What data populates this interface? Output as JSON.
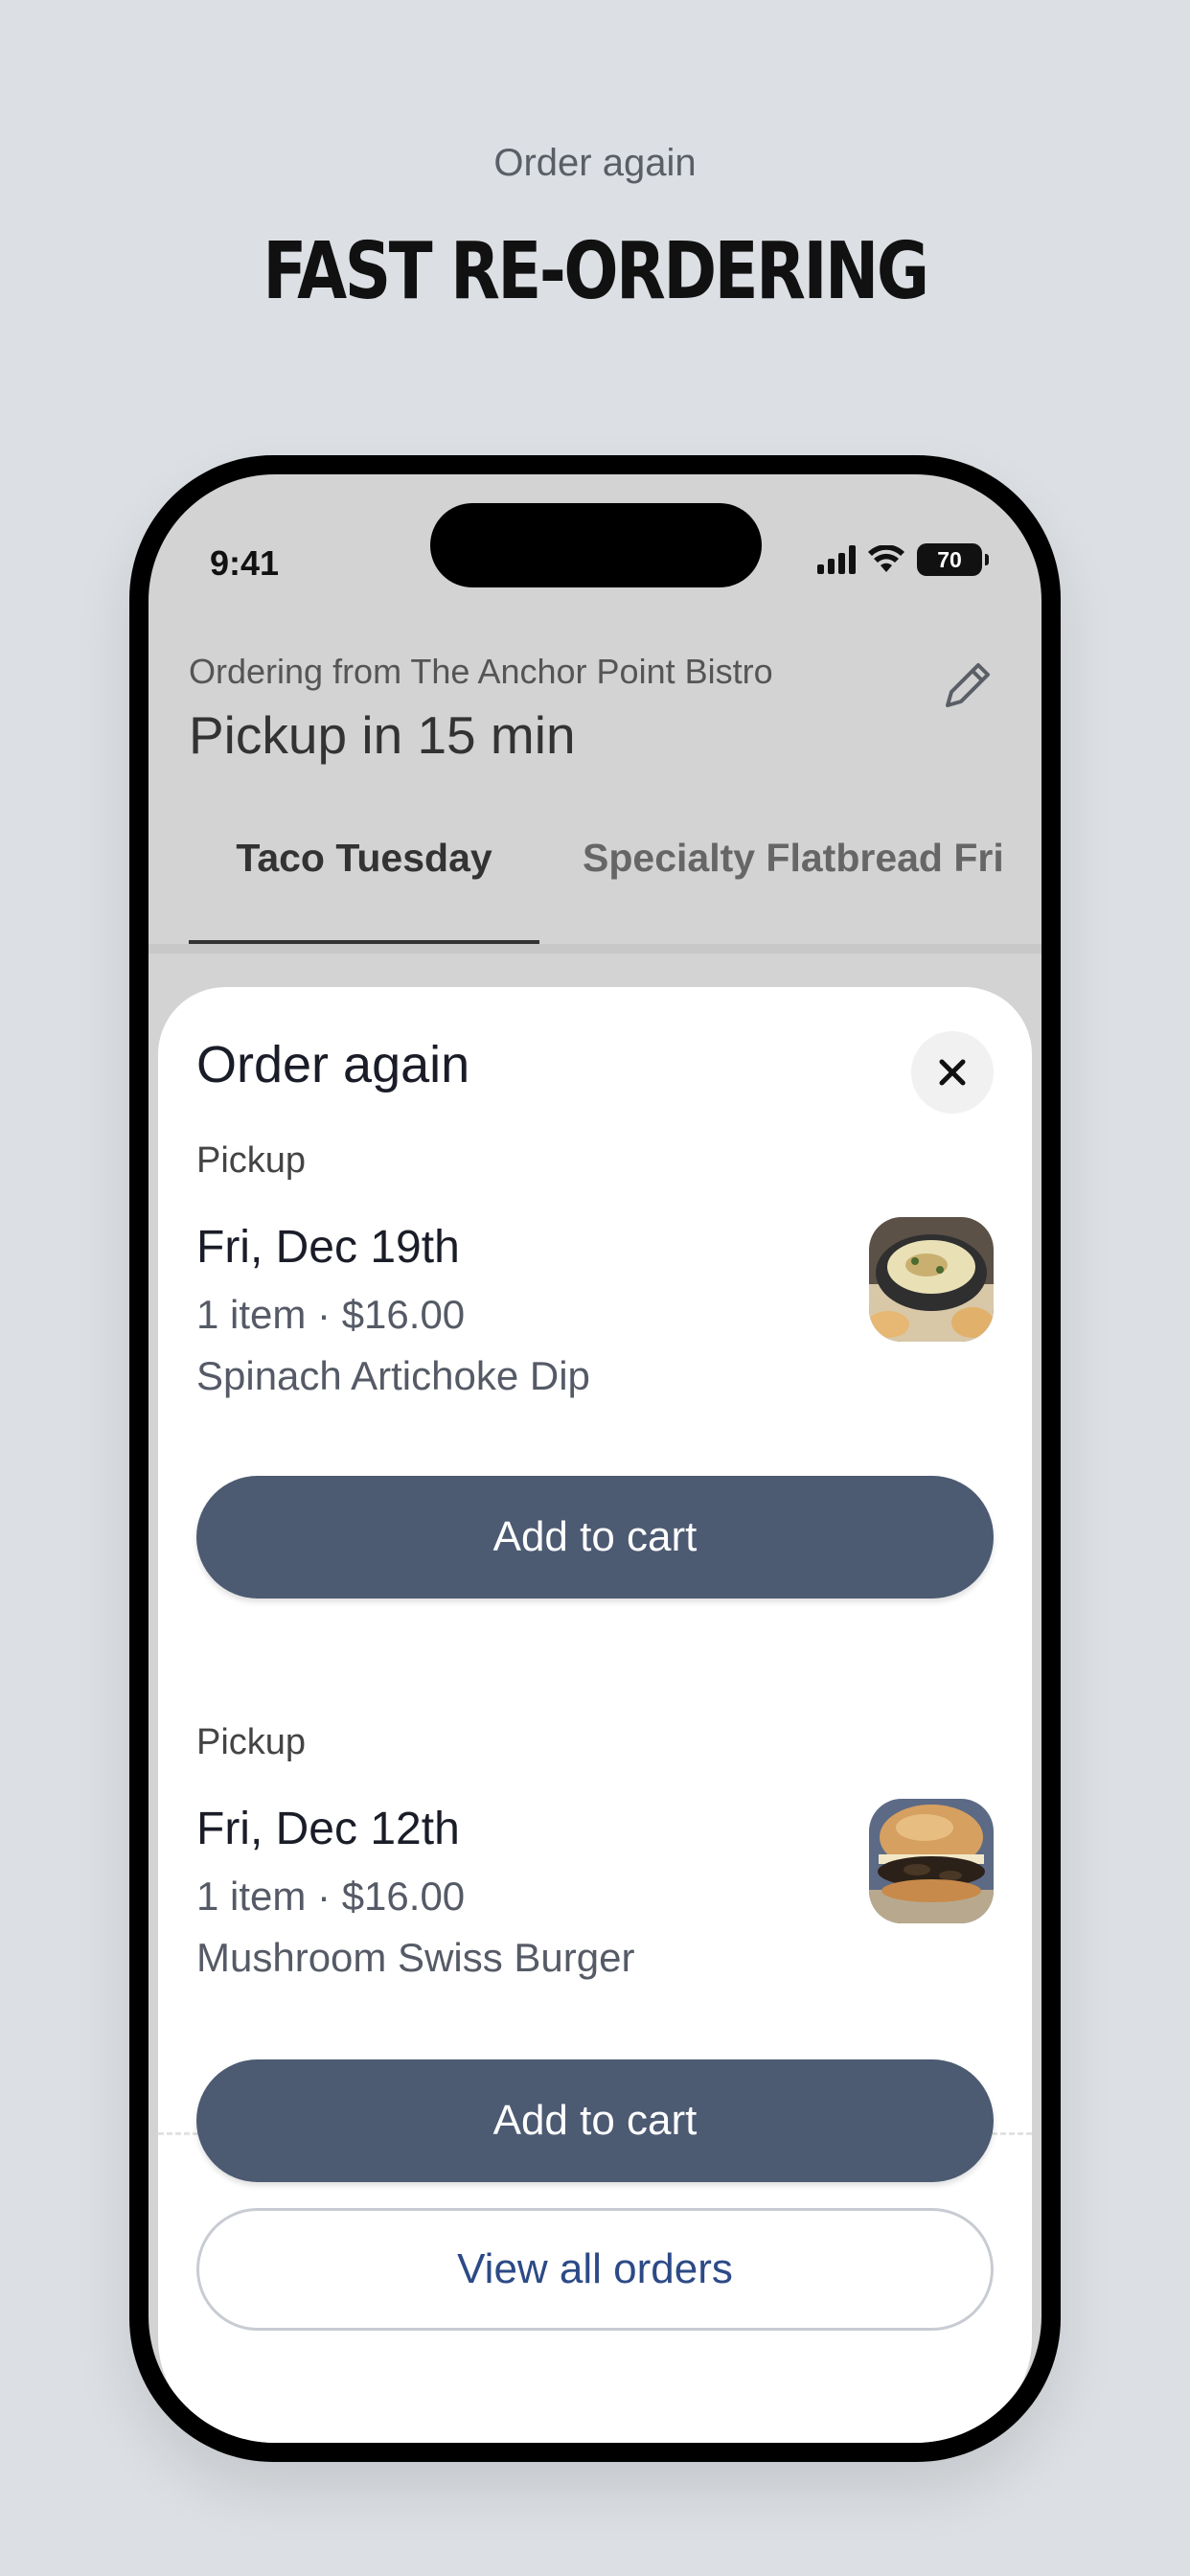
{
  "promo": {
    "eyebrow": "Order again",
    "headline": "FAST RE-ORDERING"
  },
  "status_bar": {
    "time": "9:41",
    "battery": "70",
    "icons": [
      "signal-icon",
      "wifi-icon",
      "battery-icon"
    ]
  },
  "header": {
    "subtitle": "Ordering from The Anchor Point Bistro",
    "title": "Pickup in 15 min",
    "edit_icon": "pencil-icon"
  },
  "tabs": [
    {
      "label": "Taco Tuesday",
      "active": true
    },
    {
      "label": "Specialty Flatbread Fri",
      "active": false
    }
  ],
  "sheet": {
    "title": "Order again",
    "close_icon": "close-icon",
    "orders": [
      {
        "type": "Pickup",
        "date": "Fri, Dec 19th",
        "summary": "1 item · $16.00",
        "item": "Spinach Artichoke Dip",
        "image": "spinach-artichoke-dip-photo",
        "button": "Add to cart"
      },
      {
        "type": "Pickup",
        "date": "Fri, Dec 12th",
        "summary": "1 item · $16.00",
        "item": "Mushroom Swiss Burger",
        "image": "mushroom-swiss-burger-photo",
        "button": "Add to cart"
      }
    ],
    "view_all": "View all orders"
  },
  "colors": {
    "background": "#dcdfe3",
    "primary_button": "#4c5a72",
    "link": "#2c4a86"
  }
}
